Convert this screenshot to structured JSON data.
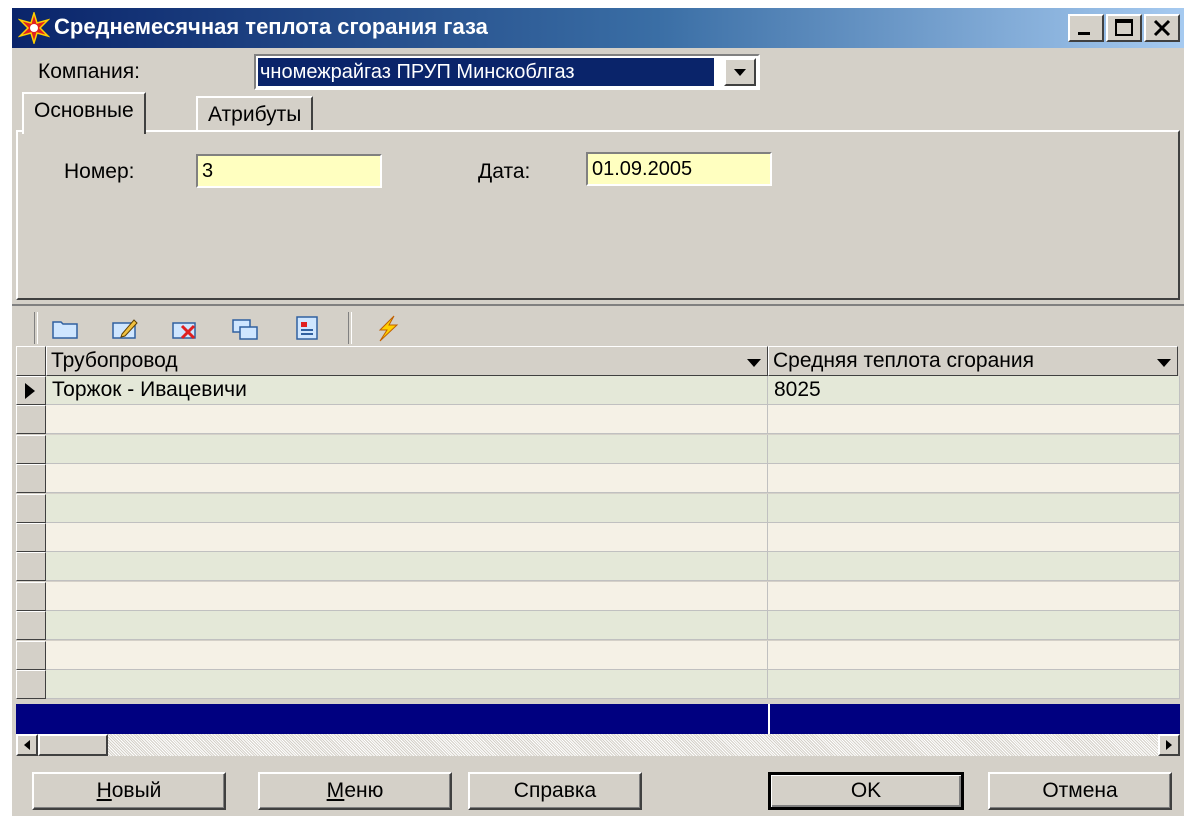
{
  "window": {
    "title": "Среднемесячная теплота сгорания газа",
    "controls": [
      "minimize-icon",
      "maximize-icon",
      "close-icon"
    ]
  },
  "company": {
    "label": "Компания:",
    "value": "чномежрайгаз ПРУП Минскоблгаз"
  },
  "tabs": [
    {
      "label": "Основные",
      "active": true
    },
    {
      "label": "Атрибуты",
      "active": false
    }
  ],
  "fields": {
    "number": {
      "label": "Номер:",
      "value": "3"
    },
    "date": {
      "label": "Дата:",
      "value": "01.09.2005"
    }
  },
  "toolbar": {
    "icons": [
      "new-record-icon",
      "edit-record-icon",
      "delete-record-icon",
      "copy-record-icon",
      "properties-icon",
      "execute-icon"
    ]
  },
  "grid": {
    "columns": [
      "Трубопровод",
      "Средняя теплота сгорания"
    ],
    "rows": [
      {
        "pipeline": "Торжок - Ивацевичи",
        "heat": "8025"
      }
    ],
    "empty_rows": 10
  },
  "buttons": {
    "new": {
      "underline": "Н",
      "rest": "овый"
    },
    "menu": {
      "underline": "М",
      "rest": "еню"
    },
    "help": "Справка",
    "ok": "OK",
    "cancel": "Отмена"
  },
  "colors": {
    "title_start": "#0a246a",
    "selection": "#000080",
    "edit_background": "#ffffc0"
  }
}
